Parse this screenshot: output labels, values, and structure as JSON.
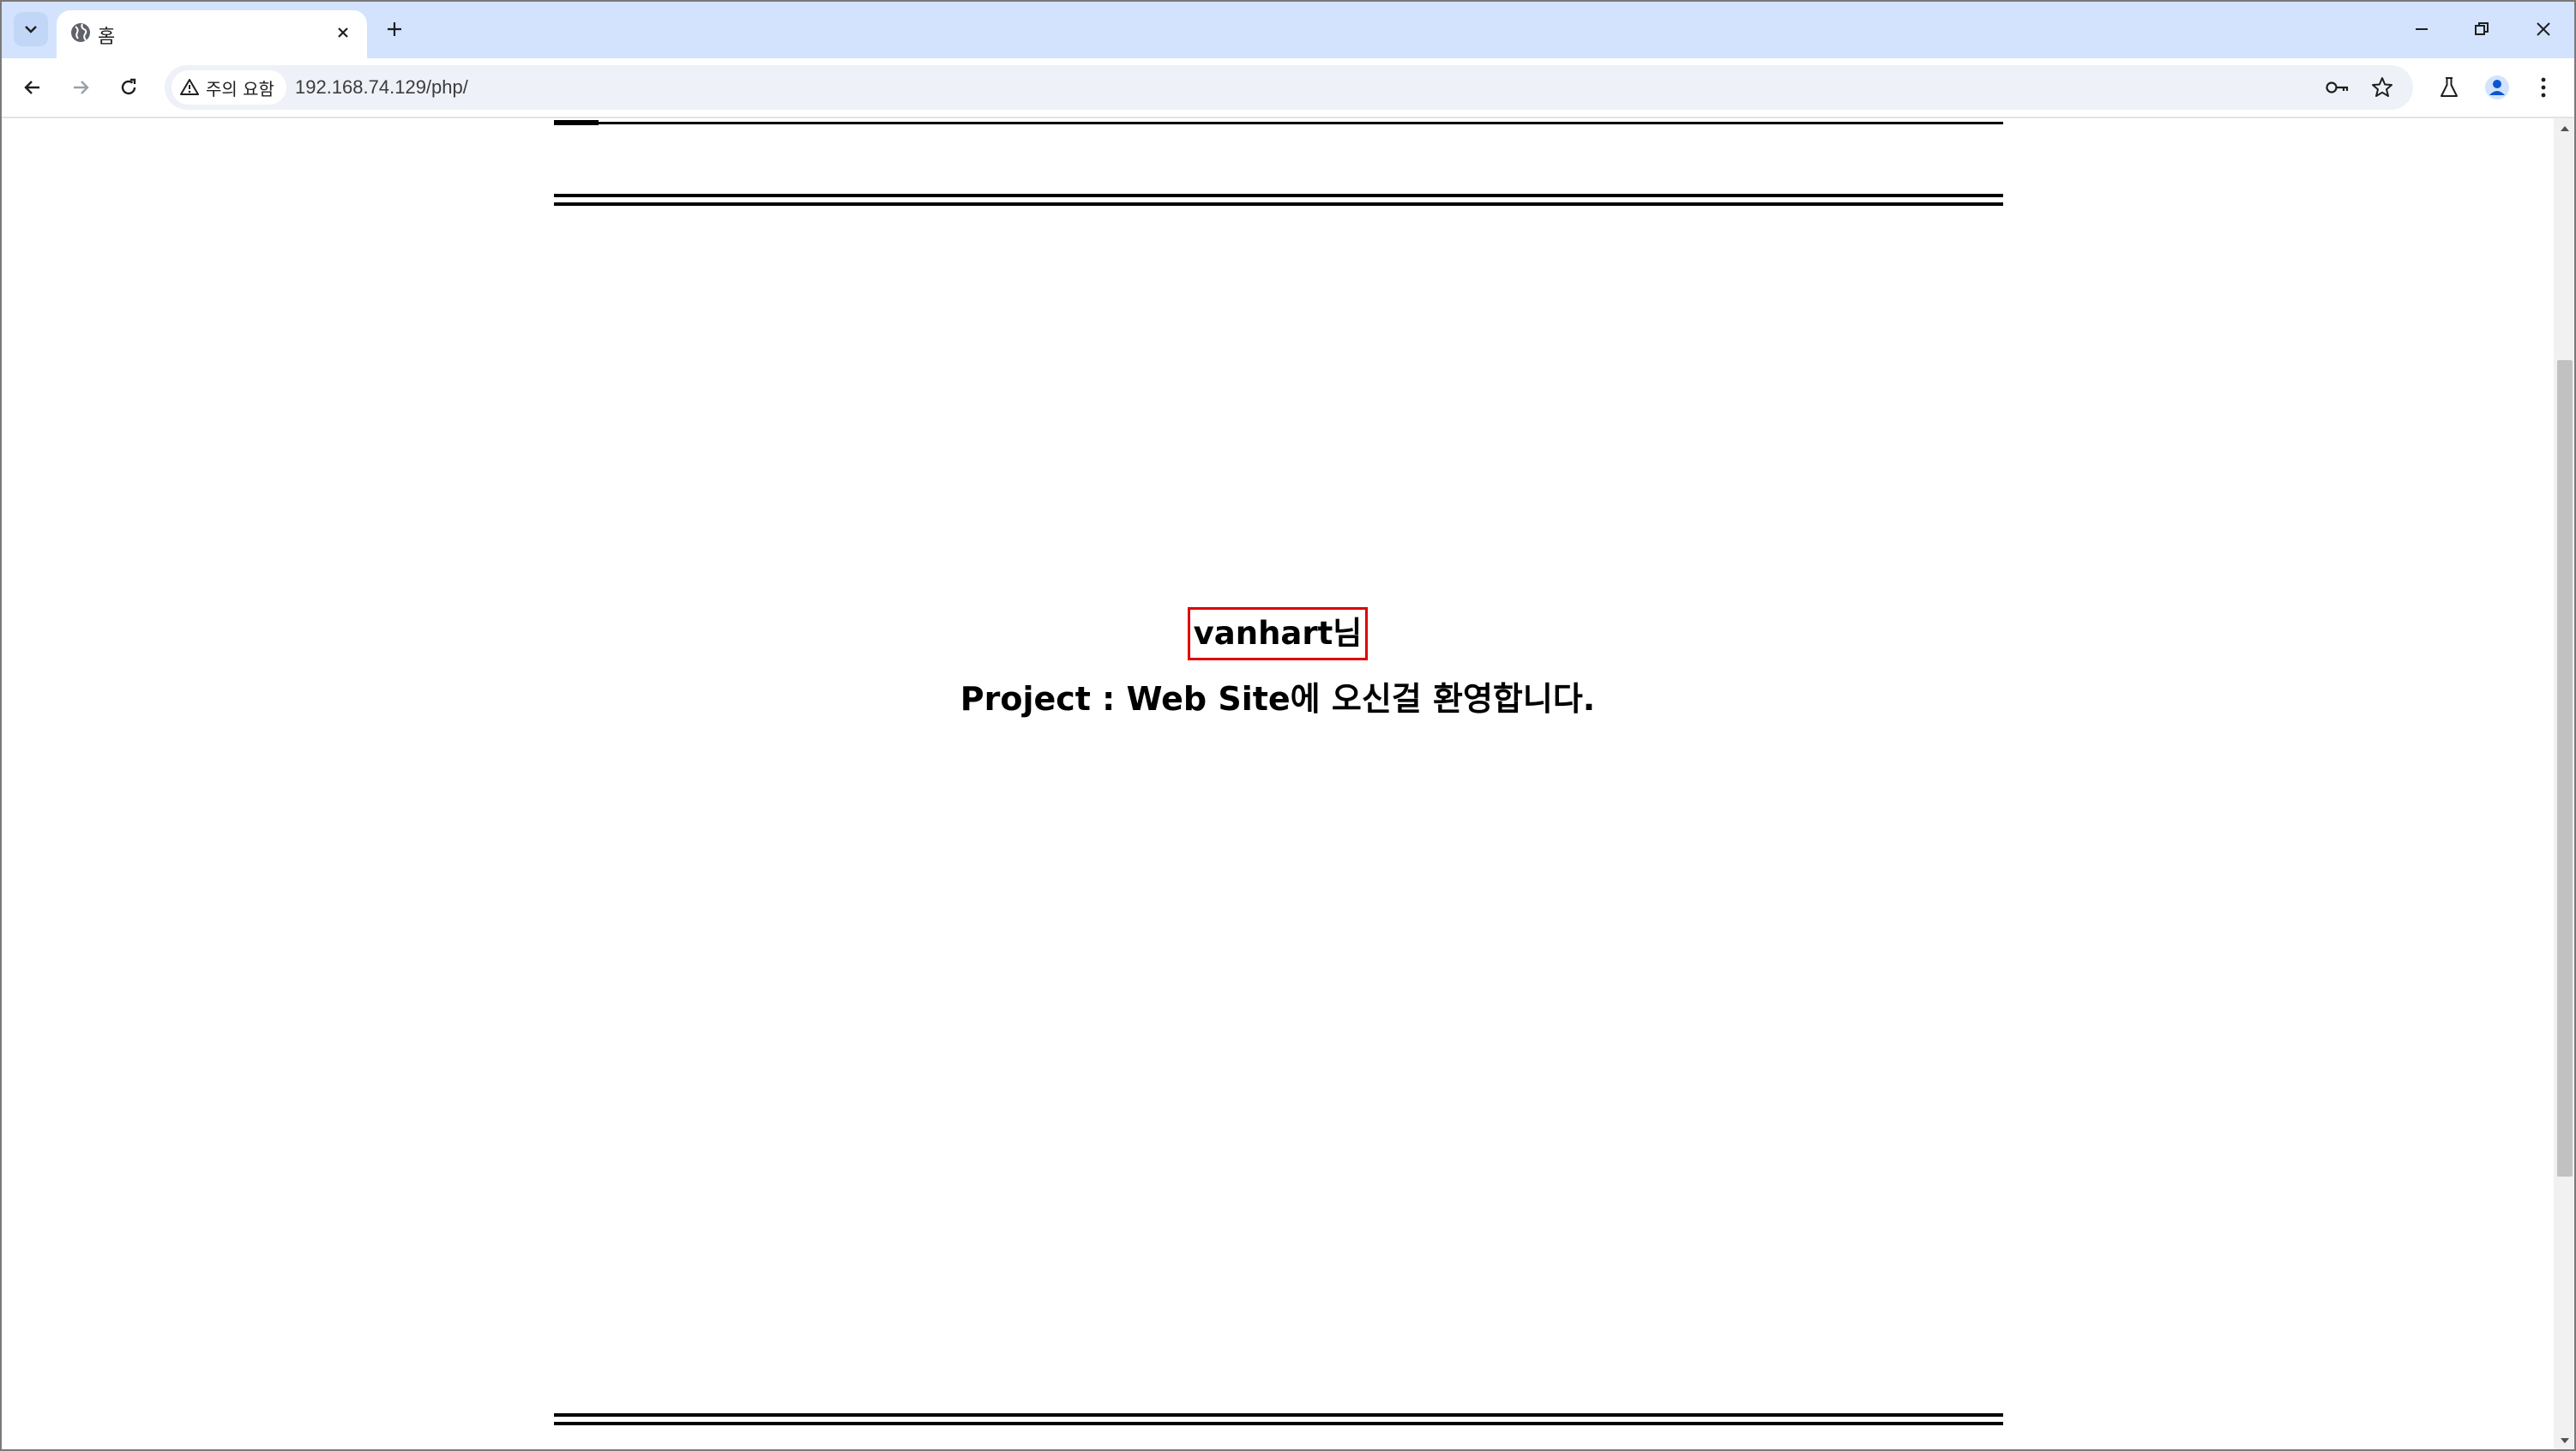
{
  "browser": {
    "tab": {
      "title": "홈",
      "favicon": "globe-icon",
      "close": "close-icon"
    },
    "new_tab": "plus-icon",
    "window_controls": [
      "minimize-icon",
      "restore-icon",
      "close-icon"
    ],
    "toolbar": {
      "back": "arrow-left-icon",
      "forward": "arrow-right-icon",
      "reload": "reload-icon",
      "security_chip": {
        "icon": "warning-icon",
        "label": "주의 요함"
      },
      "url": "192.168.74.129/php/",
      "password_icon": "key-icon",
      "bookmark_icon": "star-icon",
      "labs_icon": "flask-icon",
      "profile_icon": "profile-icon",
      "menu_icon": "kebab-menu-icon"
    }
  },
  "page": {
    "username_greeting": "vanhart님",
    "welcome_message": "Project : Web Site에 오신걸 환영합니다.",
    "highlight_color": "#e00000"
  }
}
